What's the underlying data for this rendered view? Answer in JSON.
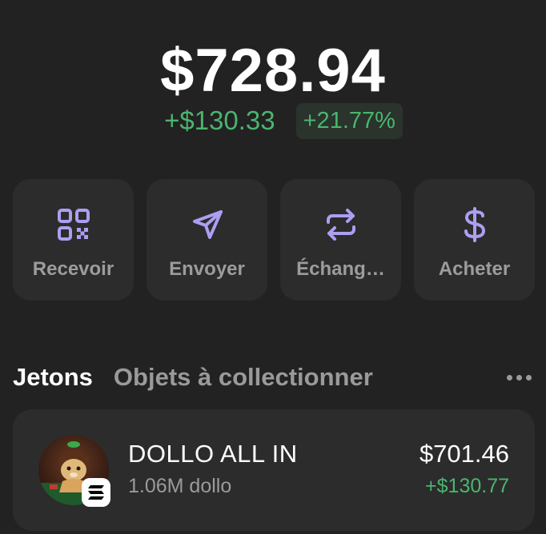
{
  "wallet": {
    "balance": "$728.94",
    "change_abs": "+$130.33",
    "change_pct": "+21.77%"
  },
  "actions": [
    {
      "label": "Recevoir",
      "icon": "qr-code-icon"
    },
    {
      "label": "Envoyer",
      "icon": "send-icon"
    },
    {
      "label": "Échang…",
      "icon": "swap-icon"
    },
    {
      "label": "Acheter",
      "icon": "dollar-icon"
    }
  ],
  "tabs": {
    "active": "Jetons",
    "inactive": "Objets à collectionner",
    "more_icon": "more-icon"
  },
  "tokens": [
    {
      "name": "DOLLO ALL IN",
      "amount": "1.06M dollo",
      "value": "$701.46",
      "change": "+$130.77",
      "avatar": "token-avatar",
      "chain_icon": "solana-icon"
    }
  ],
  "colors": {
    "background": "#222222",
    "card": "#2c2c2c",
    "accent": "#ab9ff2",
    "positive": "#4ab56f",
    "muted": "#9a9a9a"
  }
}
